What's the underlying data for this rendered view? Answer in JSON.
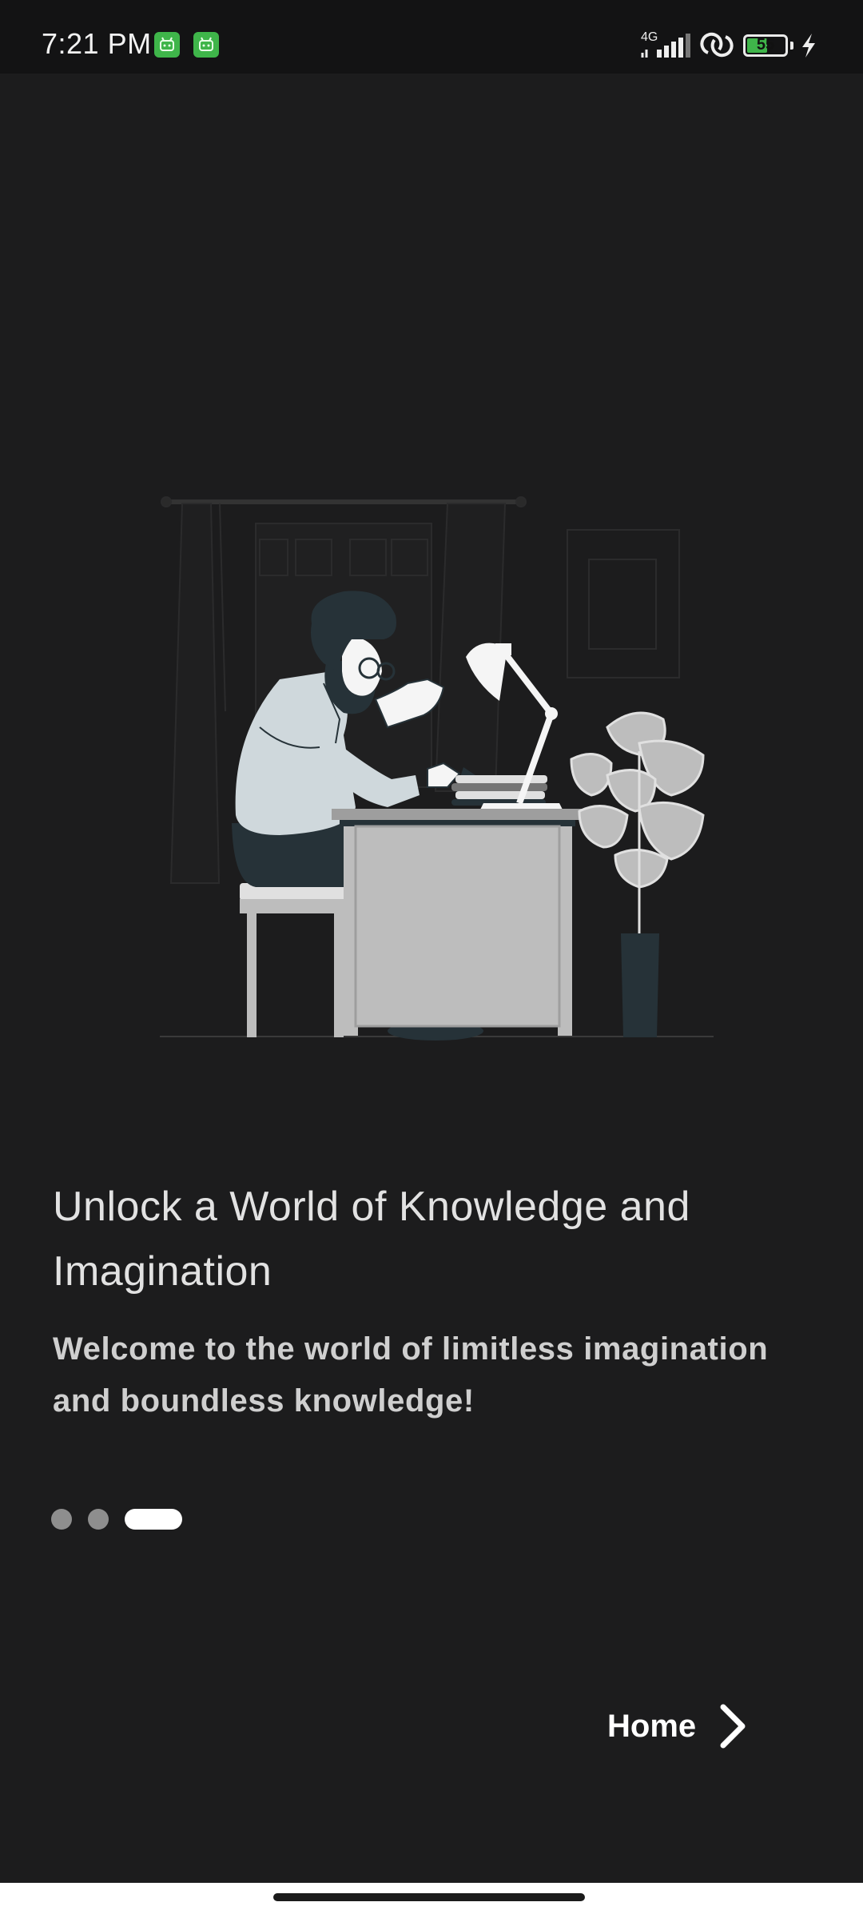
{
  "status_bar": {
    "time": "7:21 PM",
    "network_type": "4G",
    "battery_level": "55",
    "battery_percent": 55,
    "icons": [
      "app-notification-icon",
      "app-notification-icon",
      "signal-icon",
      "hotspot-icon",
      "battery-icon",
      "charging-icon"
    ]
  },
  "illustration": {
    "icon": "man-reading-at-desk-illustration"
  },
  "onboarding": {
    "title": "Unlock a World of Knowledge and Imagination",
    "subtitle": "Welcome to the world of limitless imagination and boundless knowledge!",
    "page_indicator": {
      "total": 3,
      "current": 3
    }
  },
  "footer": {
    "home_label": "Home",
    "home_icon": "chevron-right-icon"
  },
  "colors": {
    "background": "#1c1c1d",
    "accent": "#ffffff",
    "indicator_inactive": "#8e8e8e",
    "battery": "#3fb54a"
  }
}
